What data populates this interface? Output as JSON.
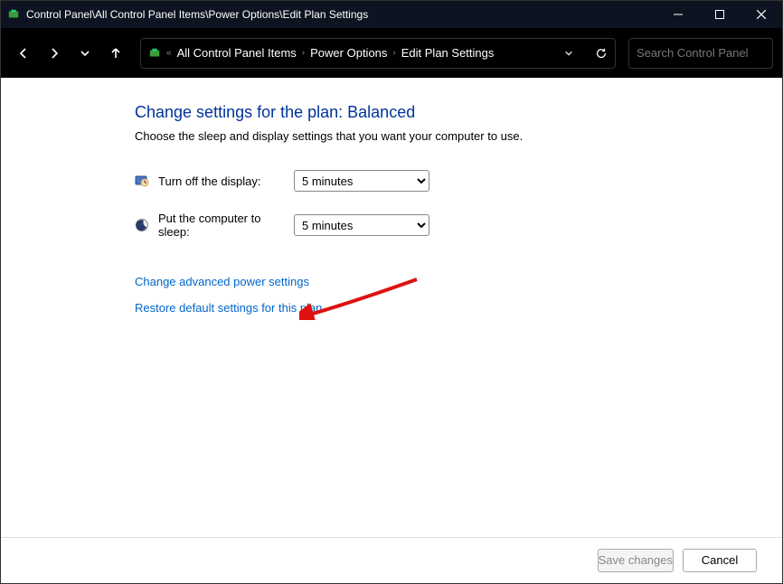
{
  "titlebar": {
    "path": "Control Panel\\All Control Panel Items\\Power Options\\Edit Plan Settings"
  },
  "breadcrumb": {
    "item1": "All Control Panel Items",
    "item2": "Power Options",
    "item3": "Edit Plan Settings"
  },
  "search": {
    "placeholder": "Search Control Panel"
  },
  "page": {
    "heading": "Change settings for the plan: Balanced",
    "description": "Choose the sleep and display settings that you want your computer to use.",
    "display_label": "Turn off the display:",
    "sleep_label": "Put the computer to sleep:",
    "display_value": "5 minutes",
    "sleep_value": "5 minutes",
    "link_advanced": "Change advanced power settings",
    "link_restore": "Restore default settings for this plan"
  },
  "footer": {
    "save": "Save changes",
    "cancel": "Cancel"
  }
}
